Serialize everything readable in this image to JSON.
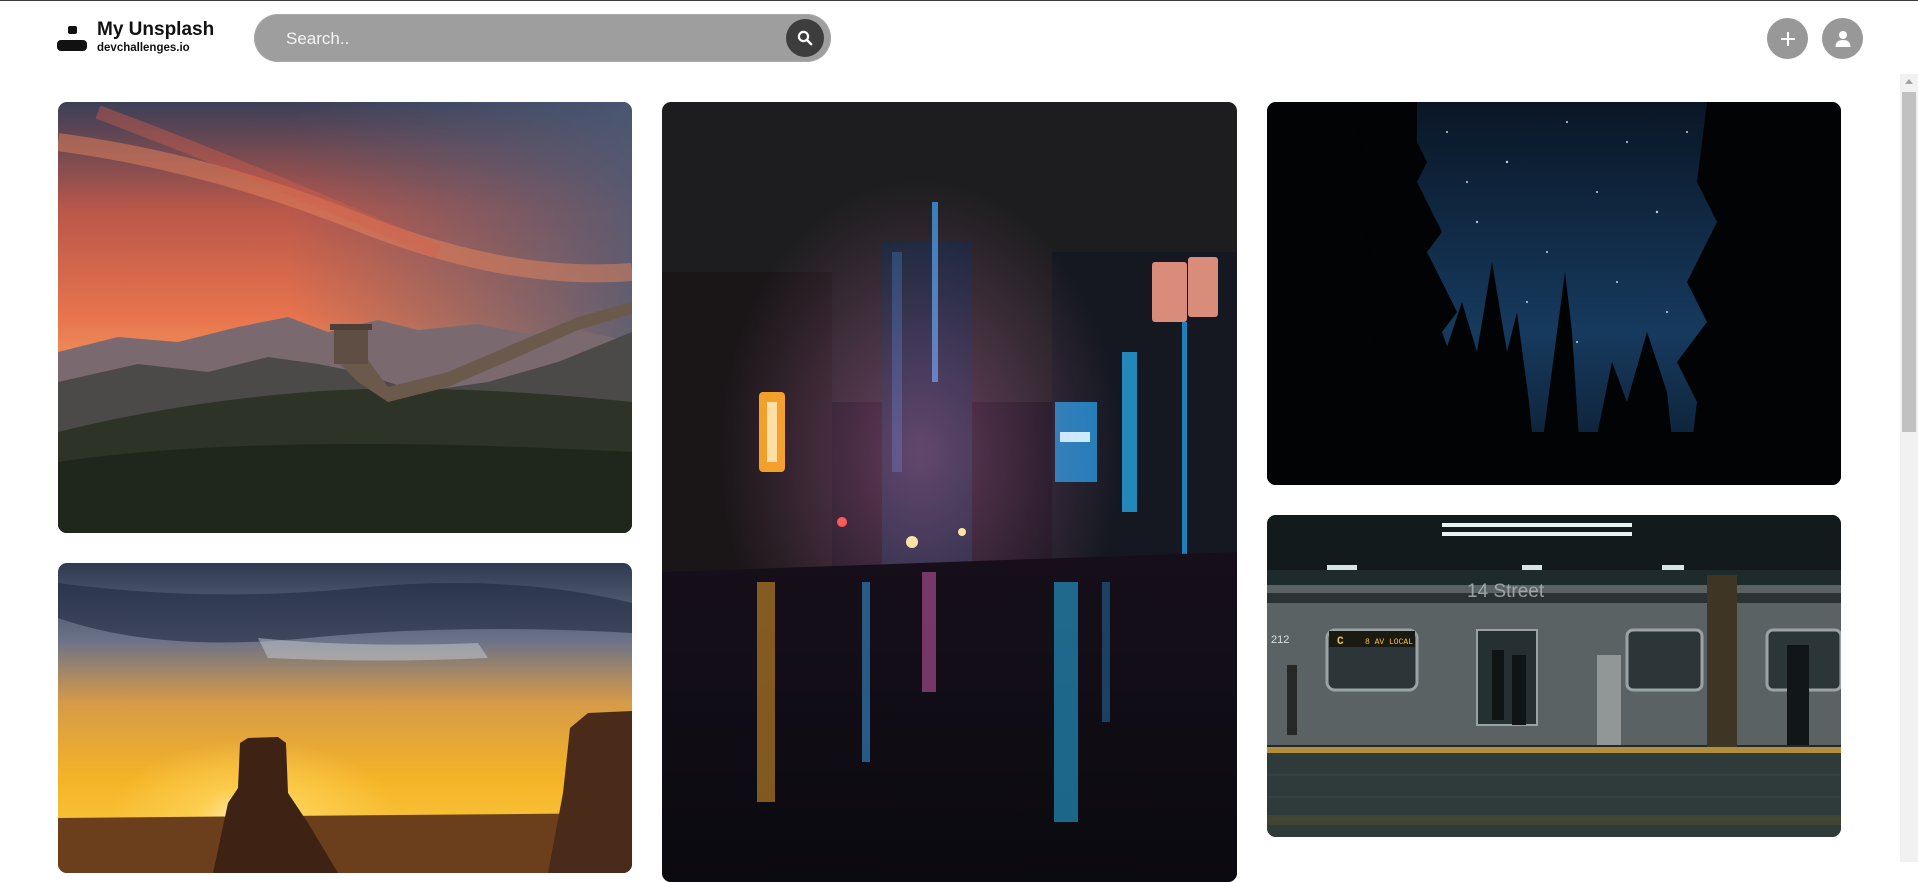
{
  "brand": {
    "title": "My Unsplash",
    "subtitle": "devchallenges.io",
    "icon": "logo-mark-icon"
  },
  "search": {
    "placeholder": "Search..",
    "value": "",
    "icon": "search-icon"
  },
  "actions": {
    "add_icon": "plus-icon",
    "profile_icon": "user-icon"
  },
  "gallery": {
    "photos": [
      {
        "subject": "Great Wall at sunset",
        "column": 1
      },
      {
        "subject": "Desert butte at sunset",
        "column": 1
      },
      {
        "subject": "Neon city street at night",
        "column": 2
      },
      {
        "subject": "Starry sky over forest",
        "column": 3
      },
      {
        "subject": "14 Street subway station",
        "column": 3
      }
    ],
    "subway_sign": "14 Street",
    "train_label": "C",
    "train_number": "212",
    "train_destination": "8 AV LOCAL"
  },
  "colors": {
    "search_bg": "#9e9e9e",
    "button_bg": "#989898",
    "text": "#111111"
  }
}
